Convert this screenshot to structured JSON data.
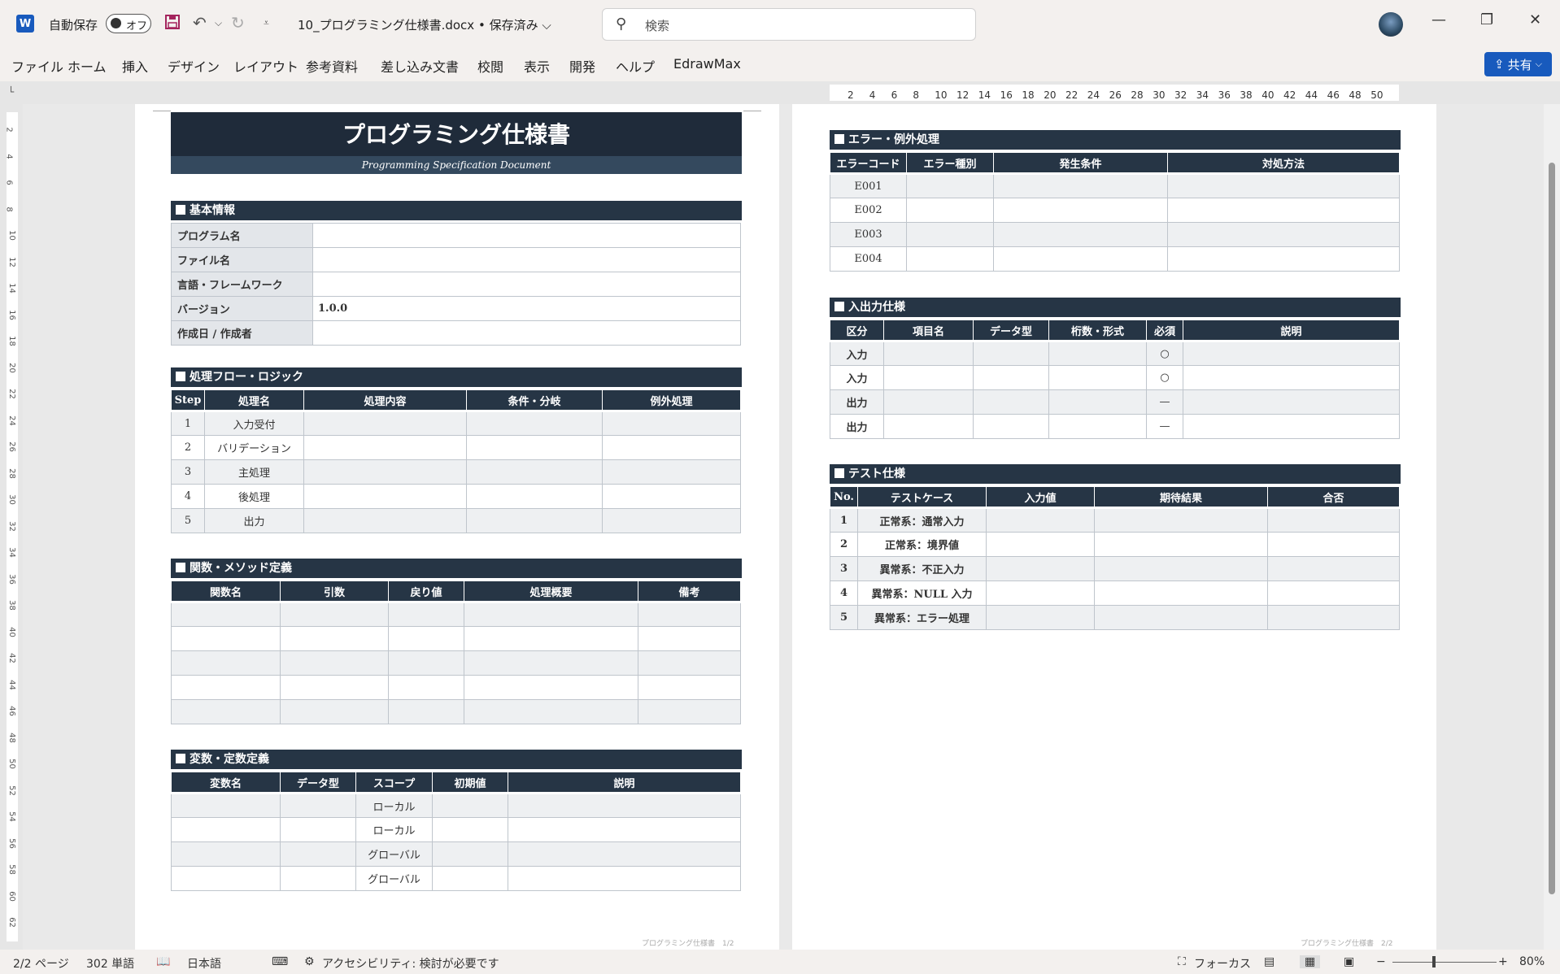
{
  "titlebar": {
    "app_logo": "W",
    "autosave_label": "自動保存",
    "autosave_state": "オフ",
    "document_title": "10_プログラミング仕様書.docx • 保存済み",
    "title_chevron": "⌵",
    "search_placeholder": "検索",
    "search_icon": "⚲",
    "minimize": "—",
    "restore": "❐",
    "close": "✕"
  },
  "ribbon": {
    "tabs": [
      "ファイル",
      "ホーム",
      "挿入",
      "デザイン",
      "レイアウト",
      "参考資料",
      "差し込み文書",
      "校閲",
      "表示",
      "開発",
      "ヘルプ",
      "EdrawMax"
    ],
    "share_label": "共有",
    "share_chevron": "⌵"
  },
  "ruler": {
    "h_marks": [
      "2",
      "4",
      "6",
      "8",
      "10",
      "12",
      "14",
      "16",
      "18",
      "20",
      "22",
      "24",
      "26",
      "28",
      "30",
      "32",
      "34",
      "36",
      "38",
      "40",
      "42",
      "44",
      "46",
      "48",
      "50"
    ],
    "v_marks": [
      "2",
      "4",
      "6",
      "8",
      "10",
      "12",
      "14",
      "16",
      "18",
      "20",
      "22",
      "24",
      "26",
      "28",
      "30",
      "32",
      "34",
      "36",
      "38",
      "40",
      "42",
      "44",
      "46",
      "48",
      "50",
      "52",
      "54",
      "56",
      "58",
      "60",
      "62"
    ]
  },
  "page1": {
    "title": "プログラミング仕様書",
    "subtitle": "Programming Specification Document",
    "basic": {
      "heading": "基本情報",
      "rows": [
        {
          "k": "プログラム名",
          "v": ""
        },
        {
          "k": "ファイル名",
          "v": ""
        },
        {
          "k": "言語・フレームワーク",
          "v": ""
        },
        {
          "k": "バージョン",
          "v": "1.0.0"
        },
        {
          "k": "作成日 / 作成者",
          "v": ""
        }
      ]
    },
    "flow": {
      "heading": "処理フロー・ロジック",
      "headers": [
        "Step",
        "処理名",
        "処理内容",
        "条件・分岐",
        "例外処理"
      ],
      "rows": [
        [
          "1",
          "入力受付",
          "",
          "",
          ""
        ],
        [
          "2",
          "バリデーション",
          "",
          "",
          ""
        ],
        [
          "3",
          "主処理",
          "",
          "",
          ""
        ],
        [
          "4",
          "後処理",
          "",
          "",
          ""
        ],
        [
          "5",
          "出力",
          "",
          "",
          ""
        ]
      ]
    },
    "func": {
      "heading": "関数・メソッド定義",
      "headers": [
        "関数名",
        "引数",
        "戻り値",
        "処理概要",
        "備考"
      ],
      "rows": [
        [
          "",
          "",
          "",
          "",
          ""
        ],
        [
          "",
          "",
          "",
          "",
          ""
        ],
        [
          "",
          "",
          "",
          "",
          ""
        ],
        [
          "",
          "",
          "",
          "",
          ""
        ],
        [
          "",
          "",
          "",
          "",
          ""
        ]
      ]
    },
    "vars": {
      "heading": "変数・定数定義",
      "headers": [
        "変数名",
        "データ型",
        "スコープ",
        "初期値",
        "説明"
      ],
      "rows": [
        [
          "",
          "",
          "ローカル",
          "",
          ""
        ],
        [
          "",
          "",
          "ローカル",
          "",
          ""
        ],
        [
          "",
          "",
          "グローバル",
          "",
          ""
        ],
        [
          "",
          "",
          "グローバル",
          "",
          ""
        ]
      ]
    },
    "footer": "プログラミング仕様書　1/2"
  },
  "page2": {
    "errors": {
      "heading": "エラー・例外処理",
      "headers": [
        "エラーコード",
        "エラー種別",
        "発生条件",
        "対処方法"
      ],
      "rows": [
        [
          "E001",
          "",
          "",
          ""
        ],
        [
          "E002",
          "",
          "",
          ""
        ],
        [
          "E003",
          "",
          "",
          ""
        ],
        [
          "E004",
          "",
          "",
          ""
        ]
      ]
    },
    "io": {
      "heading": "入出力仕様",
      "headers": [
        "区分",
        "項目名",
        "データ型",
        "桁数・形式",
        "必須",
        "説明"
      ],
      "rows": [
        [
          "入力",
          "",
          "",
          "",
          "○",
          ""
        ],
        [
          "入力",
          "",
          "",
          "",
          "○",
          ""
        ],
        [
          "出力",
          "",
          "",
          "",
          "—",
          ""
        ],
        [
          "出力",
          "",
          "",
          "",
          "—",
          ""
        ]
      ]
    },
    "tests": {
      "heading": "テスト仕様",
      "headers": [
        "No.",
        "テストケース",
        "入力値",
        "期待結果",
        "合否"
      ],
      "rows": [
        [
          "1",
          "正常系：通常入力",
          "",
          "",
          ""
        ],
        [
          "2",
          "正常系：境界値",
          "",
          "",
          ""
        ],
        [
          "3",
          "異常系：不正入力",
          "",
          "",
          ""
        ],
        [
          "4",
          "異常系：NULL 入力",
          "",
          "",
          ""
        ],
        [
          "5",
          "異常系：エラー処理",
          "",
          "",
          ""
        ]
      ]
    },
    "footer": "プログラミング仕様書　2/2"
  },
  "status": {
    "page": "2/2 ページ",
    "words": "302 単語",
    "language": "日本語",
    "accessibility": "アクセシビリティ: 検討が必要です",
    "focus": "フォーカス",
    "zoom": "80%",
    "zoom_minus": "−",
    "zoom_plus": "+"
  },
  "colors": {
    "header_navy": "#263545",
    "word_blue": "#185abd"
  }
}
